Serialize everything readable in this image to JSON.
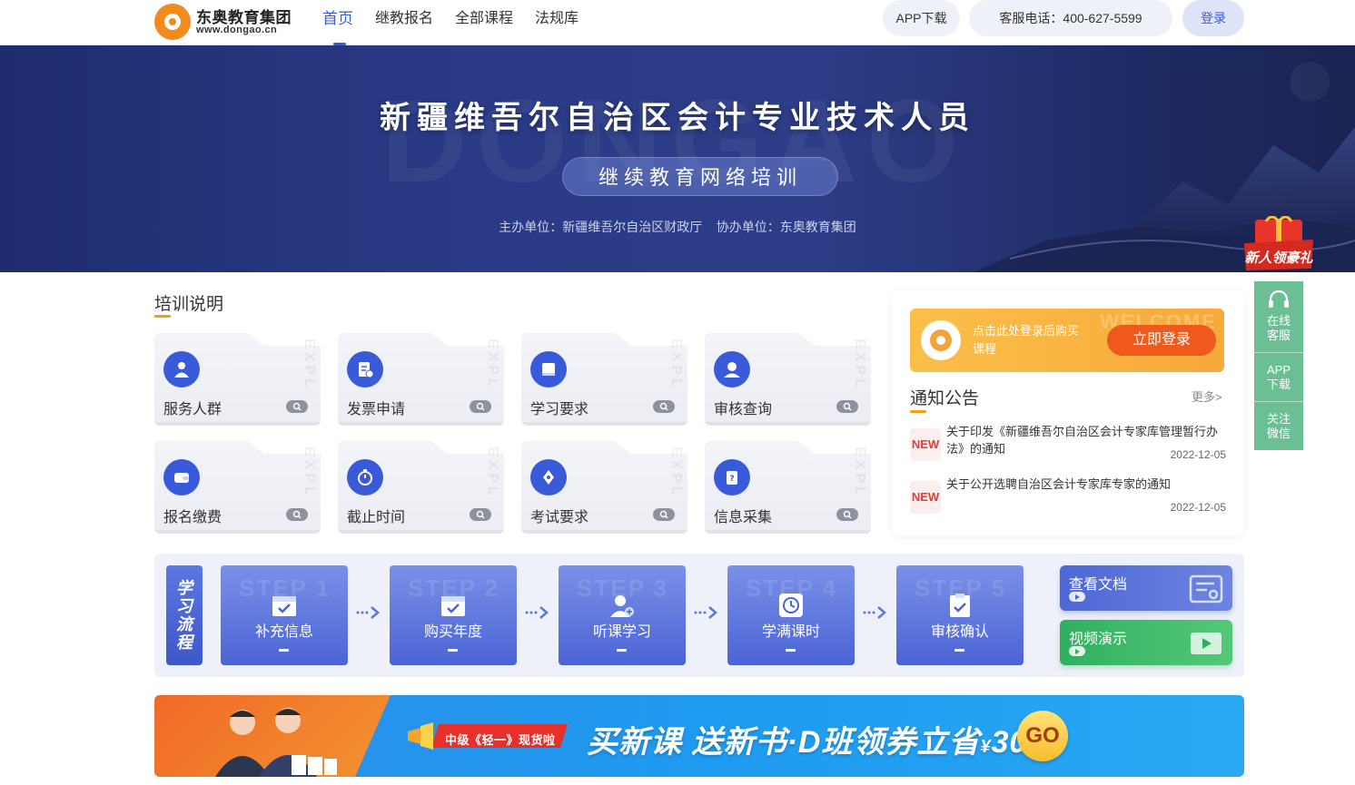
{
  "header": {
    "logo_title": "东奥教育集团",
    "logo_url": "www.dongao.cn",
    "nav": [
      {
        "label": "首页",
        "active": true
      },
      {
        "label": "继教报名",
        "active": false
      },
      {
        "label": "全部课程",
        "active": false
      },
      {
        "label": "法规库",
        "active": false
      }
    ],
    "app_download": "APP下载",
    "phone": "客服电话：400-627-5599",
    "login": "登录"
  },
  "banner": {
    "title": "新疆维吾尔自治区会计专业技术人员",
    "subtitle": "继续教育网络培训",
    "organizers": "主办单位：新疆维吾尔自治区财政厅    协办单位：东奥教育集团",
    "gift_badge": "新人领豪礼"
  },
  "training": {
    "title": "培训说明",
    "cards": [
      {
        "label": "服务人群",
        "icon": "people-icon"
      },
      {
        "label": "发票申请",
        "icon": "invoice-icon"
      },
      {
        "label": "学习要求",
        "icon": "book-icon"
      },
      {
        "label": "审核查询",
        "icon": "user-check-icon"
      },
      {
        "label": "报名缴费",
        "icon": "wallet-icon"
      },
      {
        "label": "截止时间",
        "icon": "timer-icon"
      },
      {
        "label": "考试要求",
        "icon": "pen-icon"
      },
      {
        "label": "信息采集",
        "icon": "clipboard-icon"
      }
    ]
  },
  "login_box": {
    "text": "点击此处登录后购买课程",
    "button": "立即登录"
  },
  "notices": {
    "title": "通知公告",
    "more": "更多>",
    "badge": "NEW",
    "items": [
      {
        "text": "关于印发《新疆维吾尔自治区会计专家库管理暂行办法》的通知",
        "date": "2022-12-05"
      },
      {
        "text": "关于公开选聘自治区会计专家库专家的通知",
        "date": "2022-12-05"
      }
    ]
  },
  "flow": {
    "label": "学习流程",
    "steps": [
      {
        "label": "补充信息",
        "wm": "STEP 1"
      },
      {
        "label": "购买年度",
        "wm": "STEP 2"
      },
      {
        "label": "听课学习",
        "wm": "STEP 3"
      },
      {
        "label": "学满课时",
        "wm": "STEP 4"
      },
      {
        "label": "审核确认",
        "wm": "STEP 5"
      }
    ],
    "doc_button": "查看文档",
    "video_button": "视频演示"
  },
  "promo": {
    "tag": "中级《轻一》现货啦",
    "headline": "买新课 送新书·D班领券立省",
    "currency": "¥",
    "amount": "300",
    "go": "GO"
  },
  "float_bar": {
    "items": [
      "在线客服",
      "APP下载",
      "关注微信"
    ]
  },
  "colors": {
    "accent": "#3a5bd9",
    "orange": "#f39c1e",
    "login_button": "#ef5a1c",
    "float_green": "#6cbf95"
  }
}
